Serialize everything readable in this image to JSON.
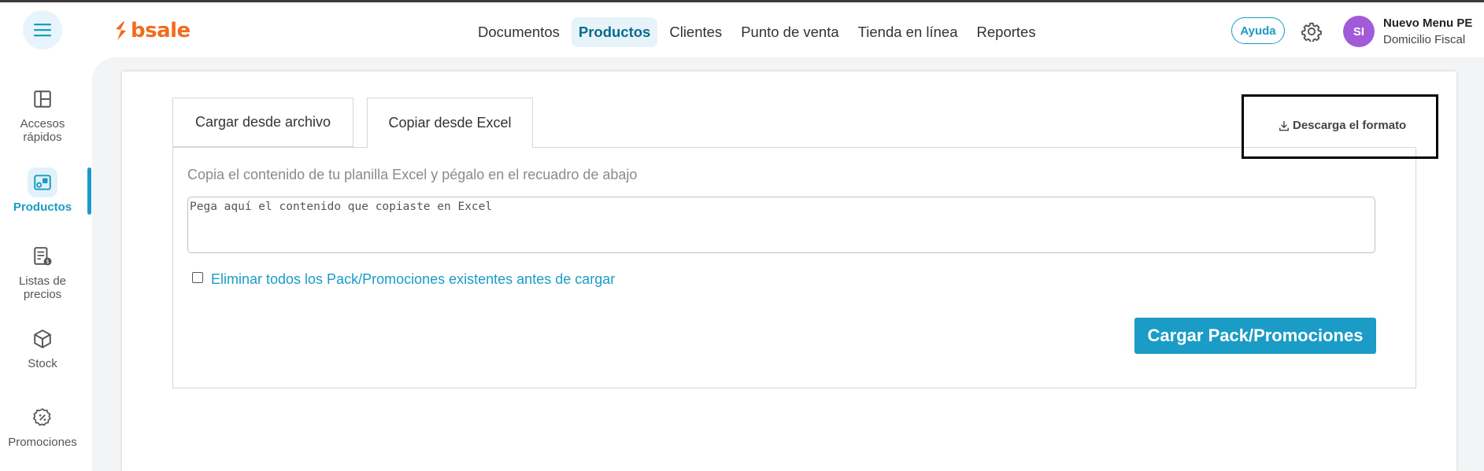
{
  "header": {
    "logo_text": "bsale",
    "nav": [
      {
        "label": "Documentos",
        "active": false
      },
      {
        "label": "Productos",
        "active": true
      },
      {
        "label": "Clientes",
        "active": false
      },
      {
        "label": "Punto de venta",
        "active": false
      },
      {
        "label": "Tienda en línea",
        "active": false
      },
      {
        "label": "Reportes",
        "active": false
      }
    ],
    "help_label": "Ayuda",
    "user": {
      "initials": "SI",
      "name": "Nuevo Menu PE",
      "subtitle": "Domicilio Fiscal"
    }
  },
  "sidebar": {
    "items": [
      {
        "label": "Accesos rápidos",
        "icon": "layout-icon",
        "active": false
      },
      {
        "label": "Productos",
        "icon": "products-icon",
        "active": true
      },
      {
        "label": "Listas de precios",
        "icon": "price-list-icon",
        "active": false
      },
      {
        "label": "Stock",
        "icon": "box-icon",
        "active": false
      },
      {
        "label": "Promociones",
        "icon": "promotion-icon",
        "active": false
      }
    ]
  },
  "tabs": {
    "file": "Cargar desde archivo",
    "excel": "Copiar desde Excel"
  },
  "download_label": "Descarga el formato",
  "content": {
    "instruction": "Copia el contenido de tu planilla Excel y pégalo en el recuadro de abajo",
    "paste_placeholder": "Pega aquí el contenido que copiaste en Excel",
    "checkbox_label": "Eliminar todos los Pack/Promociones existentes antes de cargar",
    "submit_label": "Cargar Pack/Promociones"
  },
  "colors": {
    "accent": "#1a9cc6",
    "brand": "#f26b1d",
    "avatar": "#a25bd8"
  }
}
